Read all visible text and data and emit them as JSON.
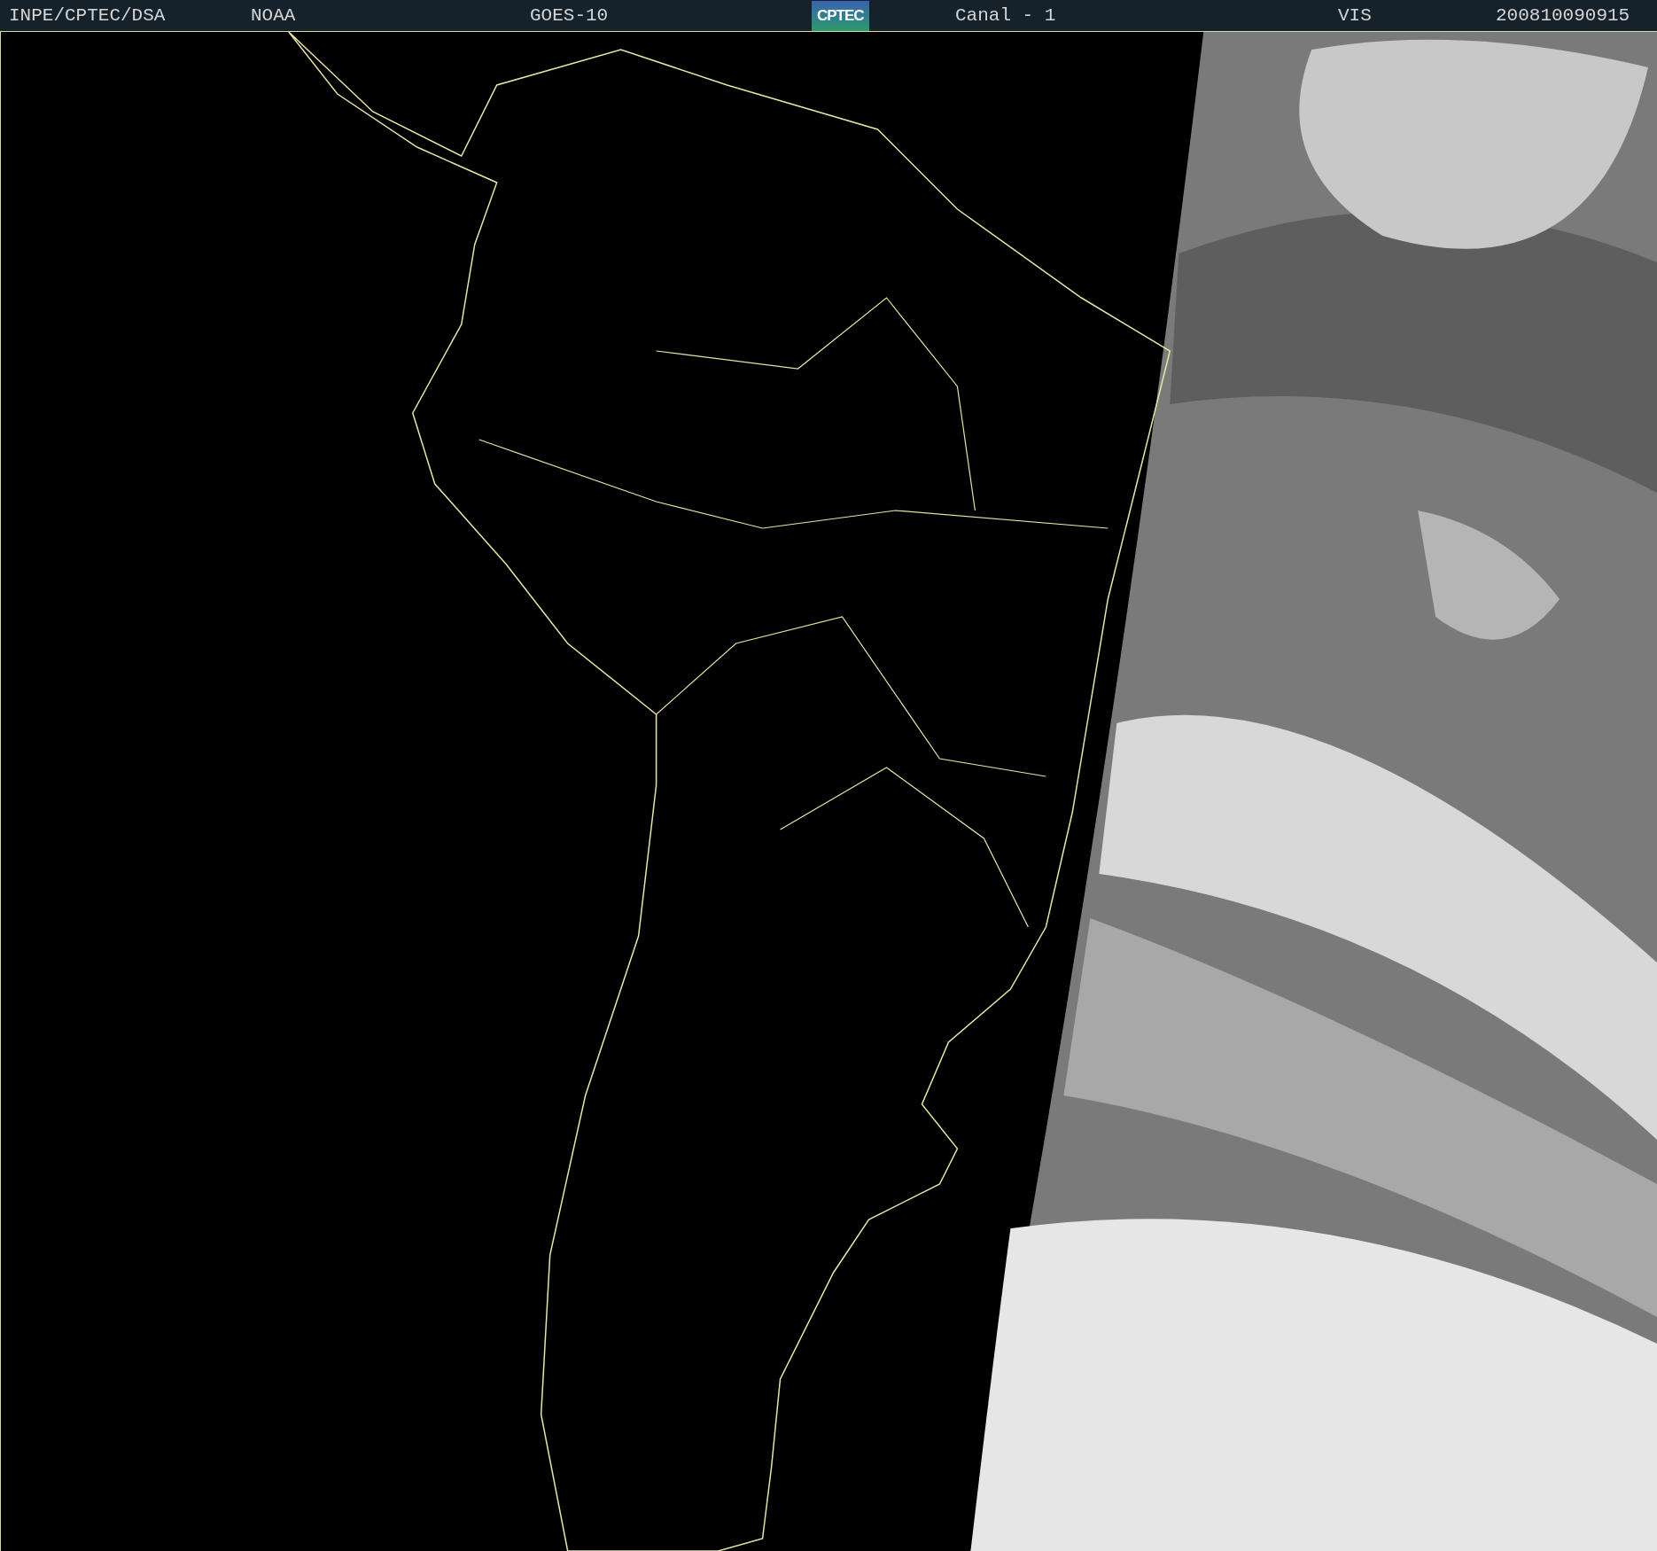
{
  "header": {
    "source": "INPE/CPTEC/DSA",
    "agency": "NOAA",
    "satellite": "GOES-10",
    "logo": "CPTEC",
    "channel": "Canal - 1",
    "band": "VIS",
    "timestamp": "200810090915"
  }
}
